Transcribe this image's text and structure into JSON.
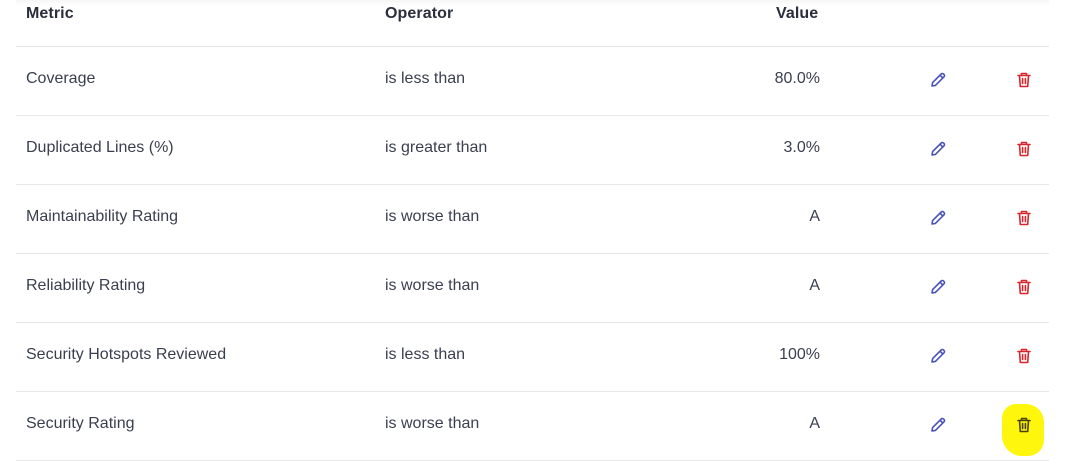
{
  "table": {
    "headers": {
      "metric": "Metric",
      "operator": "Operator",
      "value": "Value"
    },
    "rows": [
      {
        "metric": "Coverage",
        "operator": "is less than",
        "value": "80.0%"
      },
      {
        "metric": "Duplicated Lines (%)",
        "operator": "is greater than",
        "value": "3.0%"
      },
      {
        "metric": "Maintainability Rating",
        "operator": "is worse than",
        "value": "A"
      },
      {
        "metric": "Reliability Rating",
        "operator": "is worse than",
        "value": "A"
      },
      {
        "metric": "Security Hotspots Reviewed",
        "operator": "is less than",
        "value": "100%"
      },
      {
        "metric": "Security Rating",
        "operator": "is worse than",
        "value": "A"
      }
    ]
  },
  "icons": {
    "edit": "pencil-icon",
    "delete": "trash-icon"
  },
  "colors": {
    "edit_icon": "#4a53b8",
    "delete_icon": "#d8262c",
    "highlight": "#fff600",
    "row_divider": "#e6e7ea",
    "text": "#3a3f4f"
  },
  "highlighted_row_index": 5
}
